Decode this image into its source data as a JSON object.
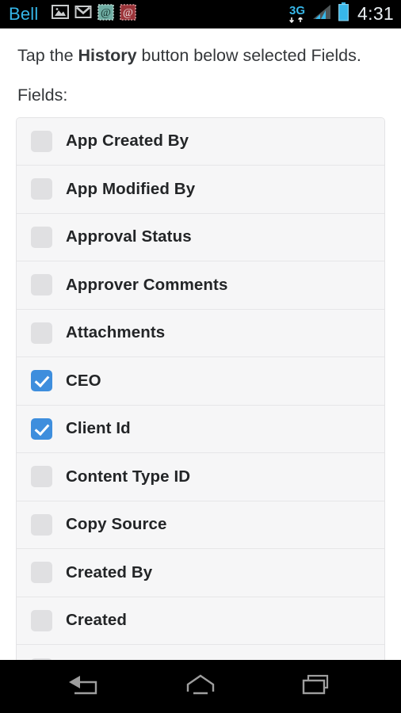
{
  "statusbar": {
    "carrier": "Bell",
    "time": "4:31",
    "network_type": "3G",
    "left_icons": [
      {
        "name": "gallery-icon",
        "color": "#c9cbcc"
      },
      {
        "name": "gmail-icon",
        "color": "#c9cbcc"
      },
      {
        "name": "email-stamp-teal-icon",
        "color": "#6fada3"
      },
      {
        "name": "email-stamp-red-icon",
        "color": "#9b3439"
      }
    ],
    "right_icons": [
      {
        "name": "signal-bars-icon",
        "color": "#37b7e9"
      },
      {
        "name": "battery-icon",
        "color": "#37b7e9"
      }
    ],
    "carrier_color": "#35b6e8",
    "accent_color": "#37b7e9"
  },
  "content": {
    "instruction_prefix": "Tap the ",
    "instruction_bold": "History",
    "instruction_suffix": " button below selected Fields.",
    "fields_label": "Fields:"
  },
  "fields": [
    {
      "label": "App Created By",
      "checked": false
    },
    {
      "label": "App Modified By",
      "checked": false
    },
    {
      "label": "Approval Status",
      "checked": false
    },
    {
      "label": "Approver Comments",
      "checked": false
    },
    {
      "label": "Attachments",
      "checked": false
    },
    {
      "label": "CEO",
      "checked": true
    },
    {
      "label": "Client Id",
      "checked": true
    },
    {
      "label": "Content Type ID",
      "checked": false
    },
    {
      "label": "Copy Source",
      "checked": false
    },
    {
      "label": "Created By",
      "checked": false
    },
    {
      "label": "Created",
      "checked": false
    },
    {
      "label": "",
      "checked": false
    }
  ],
  "colors": {
    "checkbox_checked": "#3e8edd",
    "checkbox_unchecked": "#e0e0e2",
    "row_background": "#f6f6f7",
    "row_divider": "#e6e6e8",
    "text_primary": "#232527",
    "text_body": "#34373a"
  },
  "navbar": {
    "buttons": [
      {
        "name": "back-button",
        "icon": "back-arrow-icon"
      },
      {
        "name": "home-button",
        "icon": "home-icon"
      },
      {
        "name": "recents-button",
        "icon": "recents-icon"
      }
    ],
    "icon_color": "#9e9e9e"
  }
}
